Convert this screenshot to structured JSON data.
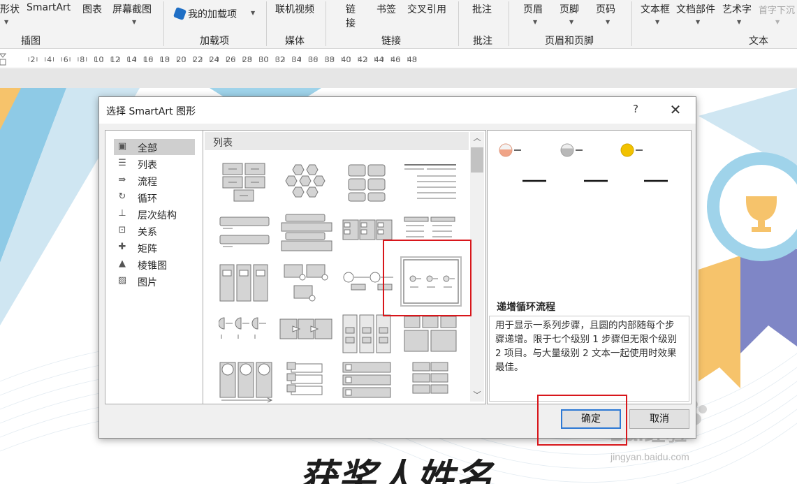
{
  "ribbon": {
    "items": [
      "形状",
      "SmartArt",
      "图表",
      "屏幕截图",
      "我的加载项",
      "联机视频",
      "链",
      "接",
      "书签",
      "交叉引用",
      "批注",
      "页眉",
      "页脚",
      "页码",
      "文本框",
      "文档部件",
      "艺术字",
      "首字下沉"
    ],
    "groups": [
      "插图",
      "加载项",
      "媒体",
      "链接",
      "批注",
      "页眉和页脚",
      "文本"
    ]
  },
  "ruler": {
    "marks": [
      "2",
      "4",
      "6",
      "8",
      "10",
      "12",
      "14",
      "16",
      "18",
      "20",
      "22",
      "24",
      "26",
      "28",
      "30",
      "32",
      "34",
      "36",
      "38",
      "40",
      "42",
      "44",
      "46",
      "48"
    ]
  },
  "dialog": {
    "title": "选择 SmartArt 图形",
    "help": "?",
    "close": "✕",
    "categories": [
      "全部",
      "列表",
      "流程",
      "循环",
      "层次结构",
      "关系",
      "矩阵",
      "棱锥图",
      "图片"
    ],
    "selected_category": "全部",
    "grid_header": "列表",
    "selected_layout": {
      "name": "递增循环流程",
      "description": "用于显示一系列步骤，且圆的内部随每个步骤递增。限于七个级别 1 步骤但无限个级别 2 项目。与大量级别 2 文本一起使用时效果最佳。"
    },
    "ok": "确定",
    "cancel": "取消"
  },
  "document": {
    "title": "获奖人姓名"
  },
  "watermark": {
    "brand": "Bai经验",
    "url": "jingyan.baidu.com"
  },
  "colors": {
    "highlight": "#d8161b",
    "ok_border": "#2c78d4",
    "accent_blue": "#8ecae6",
    "accent_orange": "#f6c36b"
  }
}
